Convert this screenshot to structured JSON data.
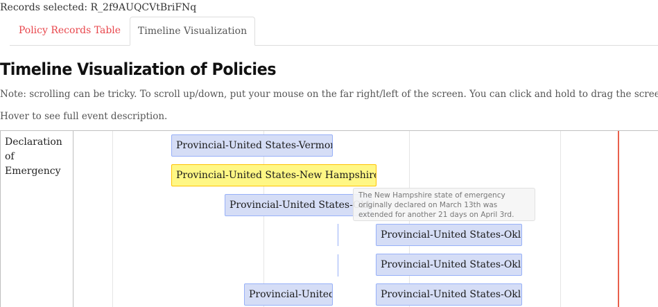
{
  "records": {
    "label": "Records selected: R_2f9AUQCVtBriFNq"
  },
  "tabs": [
    {
      "label": "Policy Records Table"
    },
    {
      "label": "Timeline Visualization"
    }
  ],
  "page": {
    "title": "Timeline Visualization of Policies",
    "note": "Note: scrolling can be tricky. To scroll up/down, put your mouse on the far right/left of the screen. You can click and hold to drag the screen.",
    "hover_hint": "Hover to see full event description."
  },
  "timeline": {
    "group_label": "Declaration of Emergency",
    "items": [
      {
        "label": "Provincial-United States-Vermont",
        "selected": false
      },
      {
        "label": "Provincial-United States-New Hampshire-T",
        "selected": true
      },
      {
        "label": "Provincial-United States-Oklah",
        "selected": false
      },
      {
        "label": "Provincial-United States-Oklah",
        "selected": false
      },
      {
        "label": "Provincial-United States-Oklah",
        "selected": false
      },
      {
        "label": "Provincial-United",
        "selected": false
      },
      {
        "label": "Provincial-United States-Oklah",
        "selected": false
      }
    ],
    "tooltip": "The New Hampshire state of emergency originally declared on March 13th was extended for another 21 days on April 3rd.",
    "colors": {
      "item_bg": "#d5ddf6",
      "item_border": "#97b0f8",
      "selected_bg": "#fff785",
      "selected_border": "#ffc200",
      "current_time": "#e8604c",
      "active_tab": "#e8454b"
    }
  }
}
